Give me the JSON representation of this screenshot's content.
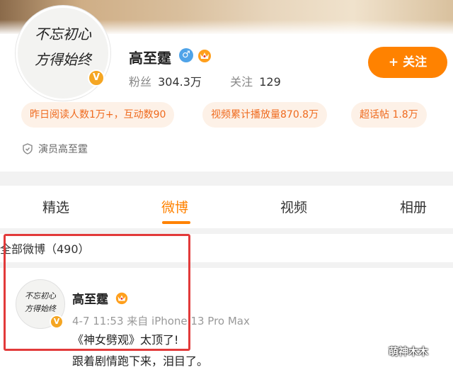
{
  "profile": {
    "name": "高至霆",
    "gender_symbol": "♂",
    "verified_badge": "V",
    "fans_label": "粉丝",
    "fans_value": "304.3万",
    "following_label": "关注",
    "following_value": "129",
    "follow_button": "+ 关注",
    "avatar_calligraphy": [
      "不忘初心",
      "方得始终"
    ],
    "occupation": "演员高至霆"
  },
  "stat_pills": [
    {
      "text": "昨日阅读人数1万+，互动数90"
    },
    {
      "text": "视频累计播放量870.8万"
    },
    {
      "text": "超话帖 1.8万"
    }
  ],
  "tabs": [
    {
      "label": "精选",
      "active": false
    },
    {
      "label": "微博",
      "active": true
    },
    {
      "label": "视频",
      "active": false
    },
    {
      "label": "相册",
      "active": false
    }
  ],
  "feed": {
    "section_title": "全部微博（490）",
    "post": {
      "user": "高至霆",
      "meta": "4-7 11:53  来自 iPhone 13 Pro Max",
      "lines": [
        "《神女劈观》太顶了!",
        "跟着剧情跑下来，泪目了。"
      ]
    }
  },
  "watermark": "萌神木木",
  "colors": {
    "accent": "#ff8200",
    "pill_bg": "#fdf1e7",
    "pill_text": "#ef6a1e",
    "highlight_box": "#e23a3a",
    "verified": "#f5a623",
    "gender": "#4fa3e8"
  }
}
